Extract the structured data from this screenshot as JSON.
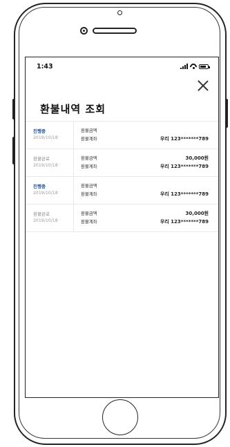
{
  "status_bar": {
    "time": "1:43",
    "icons": [
      "signal-icon",
      "wifi-icon",
      "battery-icon"
    ]
  },
  "header": {
    "title": "환불내역 조회",
    "close_icon": "close-icon"
  },
  "refunds": {
    "amount_label": "환불금액",
    "account_label": "환불계좌",
    "items": [
      {
        "status": "진행중",
        "status_type": "active",
        "date": "2019/10/18",
        "amount": "",
        "account": "우리 123*******789"
      },
      {
        "status": "환불완료",
        "status_type": "done",
        "date": "2019/10/18",
        "amount": "30,000원",
        "account": "우리 123*******789"
      },
      {
        "status": "진행중",
        "status_type": "active",
        "date": "2019/10/18",
        "amount": "",
        "account": "우리 123*******789"
      },
      {
        "status": "환불완료",
        "status_type": "done",
        "date": "2019/10/18",
        "amount": "30,000원",
        "account": "우리 123*******789"
      }
    ]
  },
  "colors": {
    "active_status": "#1e4fa0",
    "done_status": "#8a8a8a",
    "divider": "#e8e8e8"
  }
}
